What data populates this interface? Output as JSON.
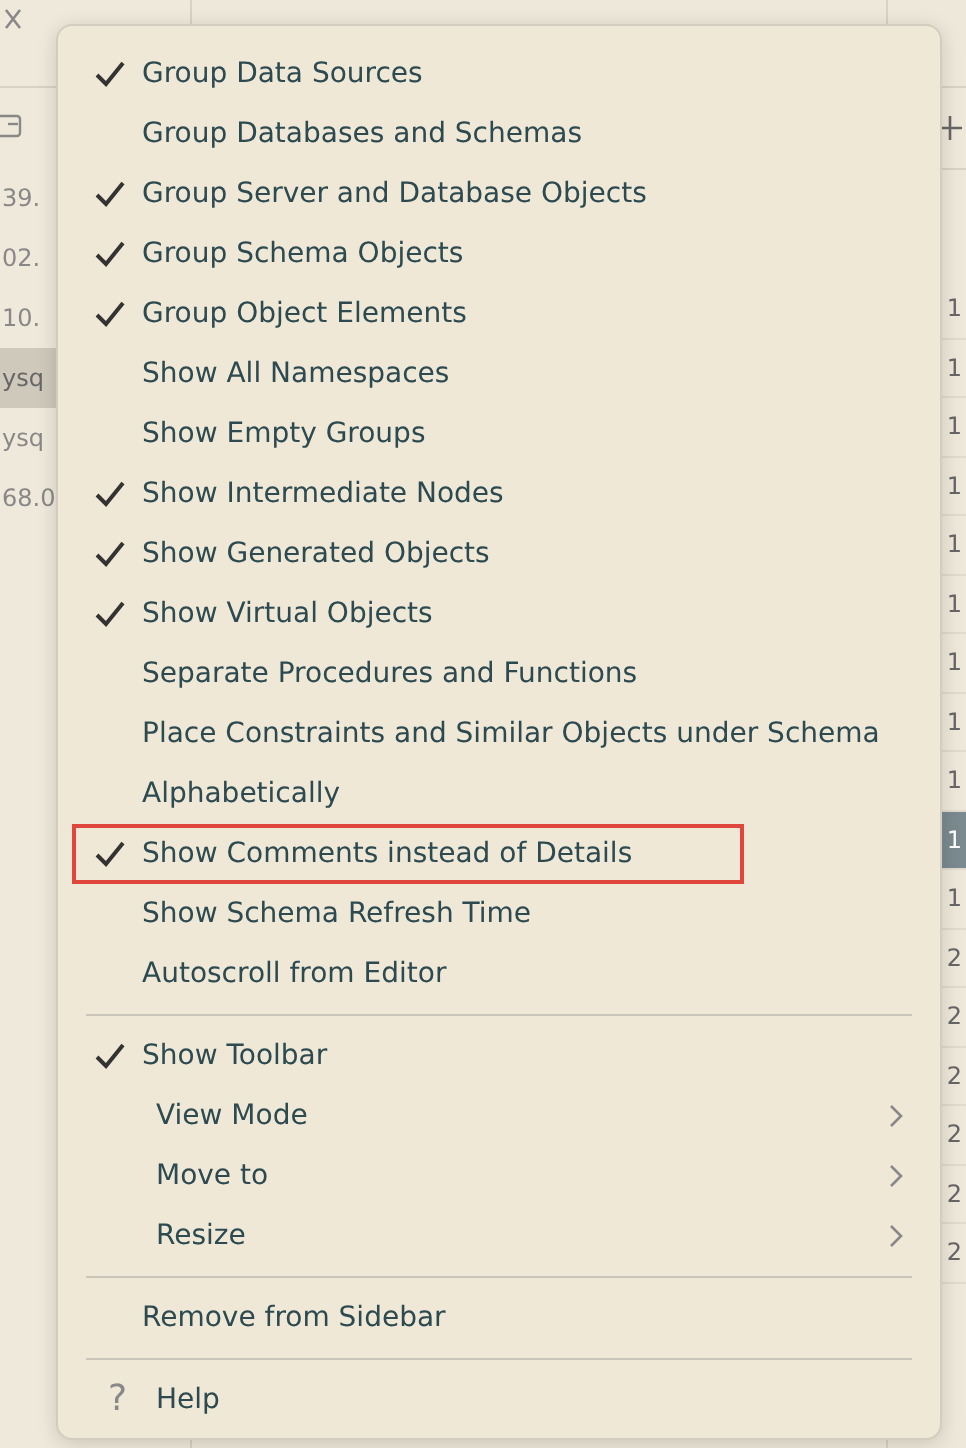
{
  "sidebar": {
    "items": [
      {
        "text": "39.",
        "selected": false
      },
      {
        "text": "02.",
        "selected": false
      },
      {
        "text": "10.",
        "selected": false
      },
      {
        "text": "ysq",
        "selected": true
      },
      {
        "text": "ysq",
        "selected": false
      },
      {
        "text": "68.0",
        "selected": false
      }
    ]
  },
  "grid": {
    "rows": [
      {
        "text": "1",
        "selected": false
      },
      {
        "text": "1",
        "selected": false
      },
      {
        "text": "1",
        "selected": false
      },
      {
        "text": "1",
        "selected": false
      },
      {
        "text": "1",
        "selected": false
      },
      {
        "text": "1",
        "selected": false
      },
      {
        "text": "1",
        "selected": false
      },
      {
        "text": "1",
        "selected": false
      },
      {
        "text": "1",
        "selected": false
      },
      {
        "text": "1",
        "selected": true
      },
      {
        "text": "1",
        "selected": false
      },
      {
        "text": "2",
        "selected": false
      },
      {
        "text": "2",
        "selected": false
      },
      {
        "text": "2",
        "selected": false
      },
      {
        "text": "2",
        "selected": false
      },
      {
        "text": "2",
        "selected": false
      },
      {
        "text": "2",
        "selected": false
      }
    ]
  },
  "menu": {
    "items": [
      {
        "kind": "toggle",
        "label": "Group Data Sources",
        "checked": true,
        "highlighted": false
      },
      {
        "kind": "toggle",
        "label": "Group Databases and Schemas",
        "checked": false,
        "highlighted": false
      },
      {
        "kind": "toggle",
        "label": "Group Server and Database Objects",
        "checked": true,
        "highlighted": false
      },
      {
        "kind": "toggle",
        "label": "Group Schema Objects",
        "checked": true,
        "highlighted": false
      },
      {
        "kind": "toggle",
        "label": "Group Object Elements",
        "checked": true,
        "highlighted": false
      },
      {
        "kind": "toggle",
        "label": "Show All Namespaces",
        "checked": false,
        "highlighted": false
      },
      {
        "kind": "toggle",
        "label": "Show Empty Groups",
        "checked": false,
        "highlighted": false
      },
      {
        "kind": "toggle",
        "label": "Show Intermediate Nodes",
        "checked": true,
        "highlighted": false
      },
      {
        "kind": "toggle",
        "label": "Show Generated Objects",
        "checked": true,
        "highlighted": false
      },
      {
        "kind": "toggle",
        "label": "Show Virtual Objects",
        "checked": true,
        "highlighted": false
      },
      {
        "kind": "toggle",
        "label": "Separate Procedures and Functions",
        "checked": false,
        "highlighted": false
      },
      {
        "kind": "toggle",
        "label": "Place Constraints and Similar Objects under Schema",
        "checked": false,
        "highlighted": false
      },
      {
        "kind": "toggle",
        "label": "Alphabetically",
        "checked": false,
        "highlighted": false
      },
      {
        "kind": "toggle",
        "label": "Show Comments instead of Details",
        "checked": true,
        "highlighted": true
      },
      {
        "kind": "toggle",
        "label": "Show Schema Refresh Time",
        "checked": false,
        "highlighted": false
      },
      {
        "kind": "toggle",
        "label": "Autoscroll from Editor",
        "checked": false,
        "highlighted": false
      },
      {
        "kind": "separator"
      },
      {
        "kind": "toggle",
        "label": "Show Toolbar",
        "checked": true,
        "highlighted": false
      },
      {
        "kind": "submenu",
        "label": "View Mode"
      },
      {
        "kind": "submenu",
        "label": "Move to"
      },
      {
        "kind": "submenu",
        "label": "Resize"
      },
      {
        "kind": "separator"
      },
      {
        "kind": "toggle",
        "label": "Remove from Sidebar",
        "checked": false,
        "highlighted": false
      },
      {
        "kind": "separator"
      },
      {
        "kind": "help",
        "glyph": "?",
        "label": "Help"
      }
    ]
  }
}
